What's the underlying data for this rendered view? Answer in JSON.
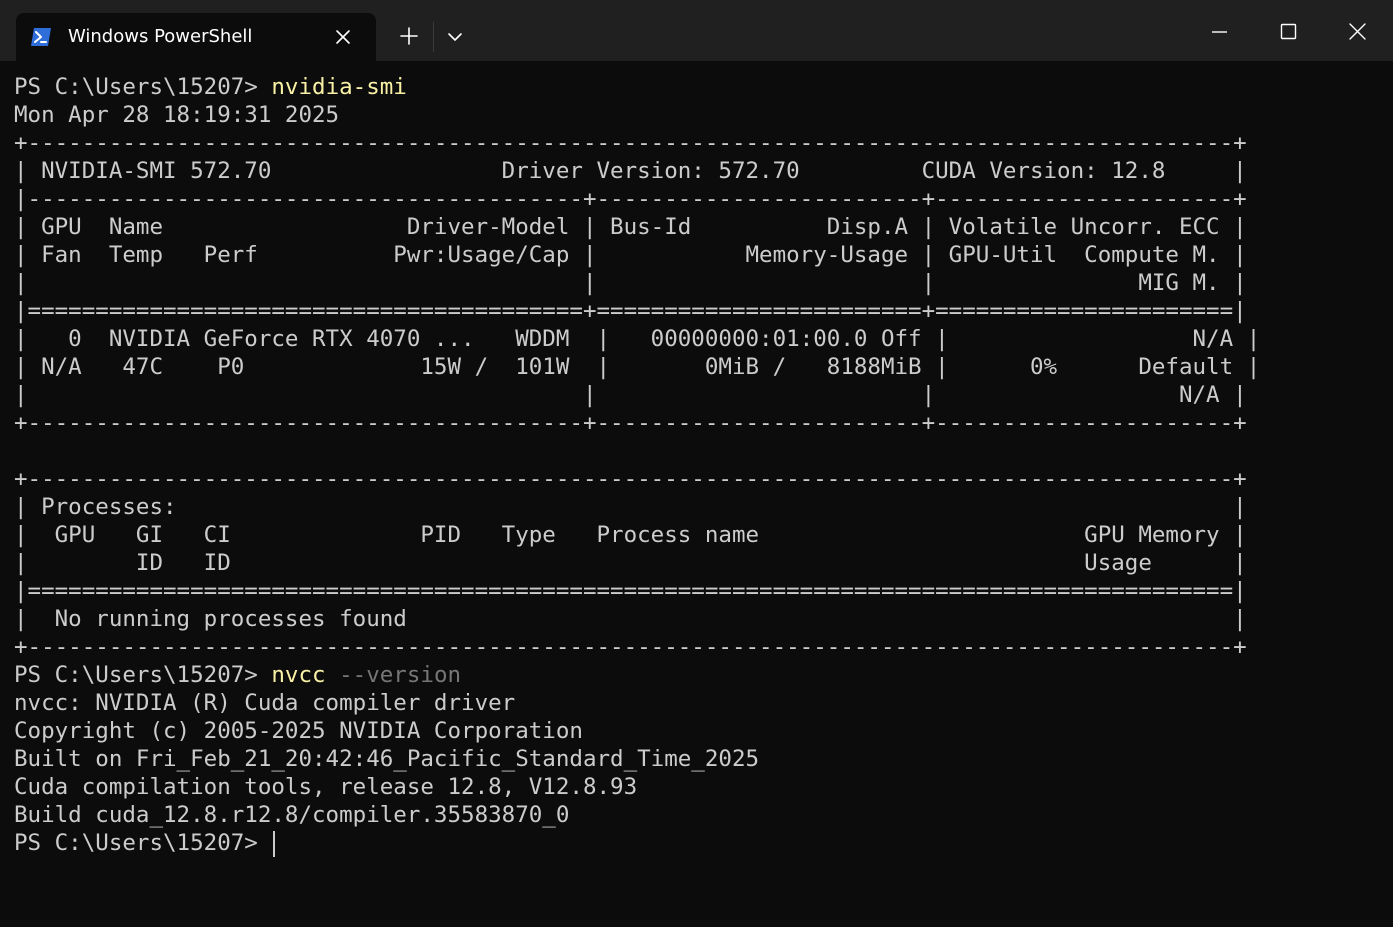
{
  "tab": {
    "title": "Windows PowerShell",
    "icon": "powershell-icon"
  },
  "titlebar_buttons": {
    "new_tab": "plus-icon",
    "dropdown": "chevron-down-icon",
    "minimize": "minimize-icon",
    "maximize": "maximize-icon",
    "close": "close-icon"
  },
  "colors": {
    "command": "#f9f1a5",
    "parameter": "#767676",
    "text": "#cccccc",
    "background": "#0c0c0c"
  },
  "terminal": {
    "line1_prompt": "PS C:\\Users\\15207> ",
    "line1_cmd": "nvidia-smi",
    "line2": "Mon Apr 28 18:19:31 2025",
    "line3": "+-----------------------------------------------------------------------------------------+",
    "line4": "| NVIDIA-SMI 572.70                 Driver Version: 572.70         CUDA Version: 12.8     |",
    "line5": "|-----------------------------------------+------------------------+----------------------+",
    "line6": "| GPU  Name                  Driver-Model | Bus-Id          Disp.A | Volatile Uncorr. ECC |",
    "line7": "| Fan  Temp   Perf          Pwr:Usage/Cap |           Memory-Usage | GPU-Util  Compute M. |",
    "line8": "|                                         |                        |               MIG M. |",
    "line9": "|=========================================+========================+======================|",
    "line10": "|   0  NVIDIA GeForce RTX 4070 ...   WDDM  |   00000000:01:00.0 Off |                  N/A |",
    "line11": "| N/A   47C    P0             15W /  101W  |       0MiB /   8188MiB |      0%      Default |",
    "line12": "|                                         |                        |                  N/A |",
    "line13": "+-----------------------------------------+------------------------+----------------------+",
    "line14": "",
    "line15": "+-----------------------------------------------------------------------------------------+",
    "line16": "| Processes:                                                                              |",
    "line17": "|  GPU   GI   CI              PID   Type   Process name                        GPU Memory |",
    "line18": "|        ID   ID                                                               Usage      |",
    "line19": "|=========================================================================================|",
    "line20": "|  No running processes found                                                             |",
    "line21": "+-----------------------------------------------------------------------------------------+",
    "line22_prompt": "PS C:\\Users\\15207> ",
    "line22_cmd": "nvcc",
    "line22_param": " --version",
    "line23": "nvcc: NVIDIA (R) Cuda compiler driver",
    "line24": "Copyright (c) 2005-2025 NVIDIA Corporation",
    "line25": "Built on Fri_Feb_21_20:42:46_Pacific_Standard_Time_2025",
    "line26": "Cuda compilation tools, release 12.8, V12.8.93",
    "line27": "Build cuda_12.8.r12.8/compiler.35583870_0",
    "line28_prompt": "PS C:\\Users\\15207> "
  }
}
